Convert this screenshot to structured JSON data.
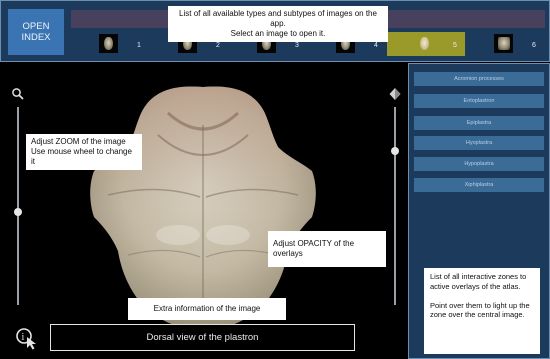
{
  "header": {
    "open_index_label": "OPEN\nINDEX",
    "thumbnails": [
      {
        "num": "1",
        "selected": false
      },
      {
        "num": "2",
        "selected": false
      },
      {
        "num": "3",
        "selected": false
      },
      {
        "num": "4",
        "selected": false
      },
      {
        "num": "5",
        "selected": true
      },
      {
        "num": "6",
        "selected": false
      }
    ],
    "tooltip": "List of all available types and subtypes of images on the app.\nSelect an image to open it."
  },
  "viewer": {
    "zoom_tooltip": "Adjust ZOOM of the image\nUse mouse wheel to change it",
    "opacity_tooltip": "Adjust OPACITY of the overlays",
    "info_tooltip": "Extra information of the image",
    "caption": "Dorsal view of the plastron",
    "zoom_level": 0.47,
    "opacity_level": 0.78
  },
  "panel": {
    "zones": [
      "Acromion processes",
      "Entoplastron",
      "Epiplastra",
      "Hyoplastra",
      "Hypoplastra",
      "Xiphiplastra"
    ],
    "tooltip": "List of all interactive zones to active overlays of the atlas.\n\nPoint over them to light up the zone over the central image."
  },
  "colors": {
    "header_bg": "#1c3a5c",
    "open_index_bg": "#3a74b3",
    "zone_button_bg": "#3b6b97",
    "selected_thumb_bg": "#9a9a2a"
  }
}
